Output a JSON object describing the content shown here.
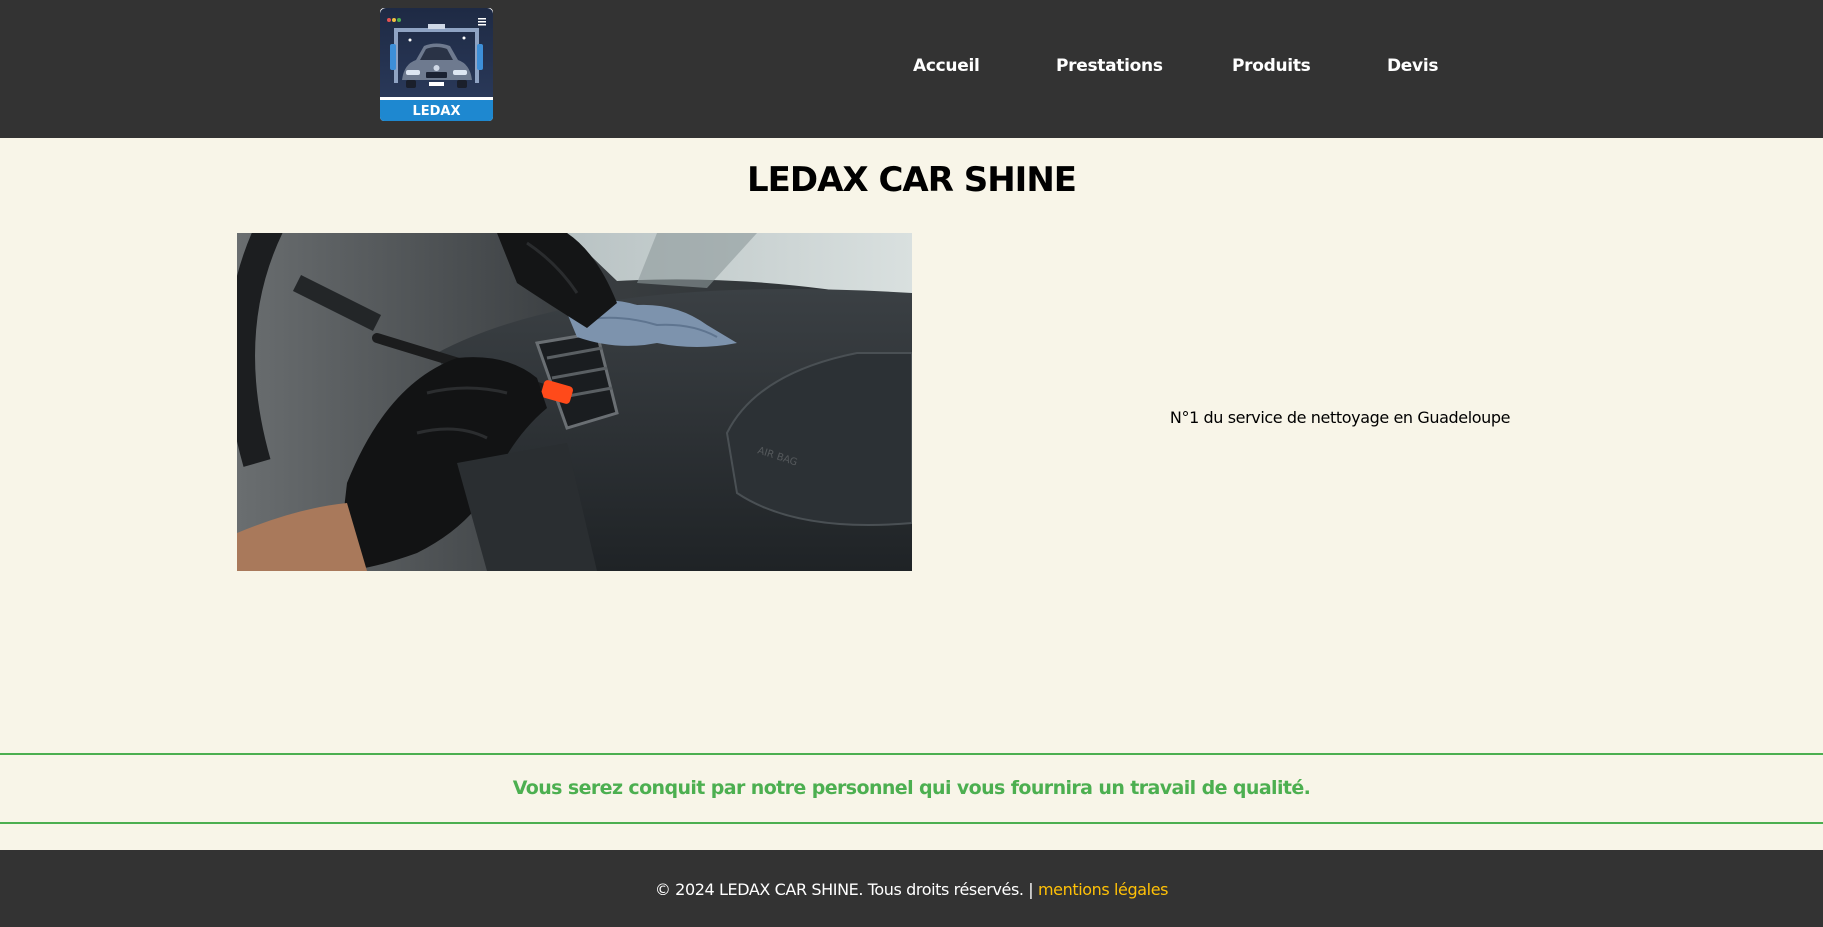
{
  "header": {
    "logo_text": "LEDAX",
    "nav": [
      {
        "label": "Accueil"
      },
      {
        "label": "Prestations"
      },
      {
        "label": "Produits"
      },
      {
        "label": "Devis"
      }
    ]
  },
  "main": {
    "title": "LEDAX CAR SHINE",
    "tagline": "N°1 du service de nettoyage en Guadeloupe"
  },
  "quality": {
    "text": "Vous serez conquit par notre personnel qui vous fournira un travail de qualité."
  },
  "footer": {
    "copyright": "© 2024 LEDAX CAR SHINE. Tous droits réservés. |",
    "legal_link": "mentions légales"
  },
  "colors": {
    "header_bg": "#333333",
    "page_bg": "#f8f5e8",
    "accent_green": "#4caf50",
    "link_yellow": "#ffc107"
  }
}
